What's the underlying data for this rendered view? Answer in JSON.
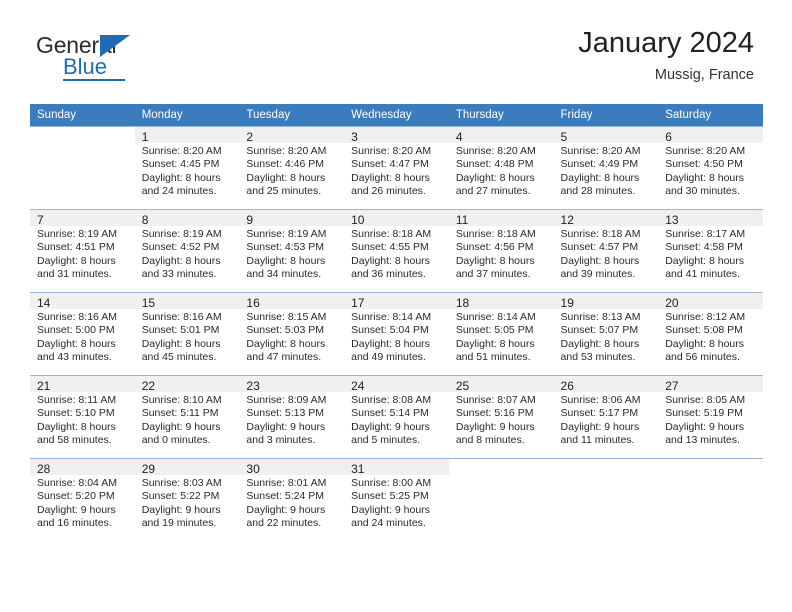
{
  "brand": {
    "name_part1": "General",
    "name_part2": "Blue",
    "accent_color": "#1f6cb4"
  },
  "header": {
    "title": "January 2024",
    "location": "Mussig, France"
  },
  "calendar": {
    "header_color": "#3a7cbd",
    "weekdays": [
      "Sunday",
      "Monday",
      "Tuesday",
      "Wednesday",
      "Thursday",
      "Friday",
      "Saturday"
    ],
    "weeks": [
      [
        {
          "day": "",
          "sunrise": "",
          "sunset": "",
          "daylight1": "",
          "daylight2": ""
        },
        {
          "day": "1",
          "sunrise": "Sunrise: 8:20 AM",
          "sunset": "Sunset: 4:45 PM",
          "daylight1": "Daylight: 8 hours",
          "daylight2": "and 24 minutes."
        },
        {
          "day": "2",
          "sunrise": "Sunrise: 8:20 AM",
          "sunset": "Sunset: 4:46 PM",
          "daylight1": "Daylight: 8 hours",
          "daylight2": "and 25 minutes."
        },
        {
          "day": "3",
          "sunrise": "Sunrise: 8:20 AM",
          "sunset": "Sunset: 4:47 PM",
          "daylight1": "Daylight: 8 hours",
          "daylight2": "and 26 minutes."
        },
        {
          "day": "4",
          "sunrise": "Sunrise: 8:20 AM",
          "sunset": "Sunset: 4:48 PM",
          "daylight1": "Daylight: 8 hours",
          "daylight2": "and 27 minutes."
        },
        {
          "day": "5",
          "sunrise": "Sunrise: 8:20 AM",
          "sunset": "Sunset: 4:49 PM",
          "daylight1": "Daylight: 8 hours",
          "daylight2": "and 28 minutes."
        },
        {
          "day": "6",
          "sunrise": "Sunrise: 8:20 AM",
          "sunset": "Sunset: 4:50 PM",
          "daylight1": "Daylight: 8 hours",
          "daylight2": "and 30 minutes."
        }
      ],
      [
        {
          "day": "7",
          "sunrise": "Sunrise: 8:19 AM",
          "sunset": "Sunset: 4:51 PM",
          "daylight1": "Daylight: 8 hours",
          "daylight2": "and 31 minutes."
        },
        {
          "day": "8",
          "sunrise": "Sunrise: 8:19 AM",
          "sunset": "Sunset: 4:52 PM",
          "daylight1": "Daylight: 8 hours",
          "daylight2": "and 33 minutes."
        },
        {
          "day": "9",
          "sunrise": "Sunrise: 8:19 AM",
          "sunset": "Sunset: 4:53 PM",
          "daylight1": "Daylight: 8 hours",
          "daylight2": "and 34 minutes."
        },
        {
          "day": "10",
          "sunrise": "Sunrise: 8:18 AM",
          "sunset": "Sunset: 4:55 PM",
          "daylight1": "Daylight: 8 hours",
          "daylight2": "and 36 minutes."
        },
        {
          "day": "11",
          "sunrise": "Sunrise: 8:18 AM",
          "sunset": "Sunset: 4:56 PM",
          "daylight1": "Daylight: 8 hours",
          "daylight2": "and 37 minutes."
        },
        {
          "day": "12",
          "sunrise": "Sunrise: 8:18 AM",
          "sunset": "Sunset: 4:57 PM",
          "daylight1": "Daylight: 8 hours",
          "daylight2": "and 39 minutes."
        },
        {
          "day": "13",
          "sunrise": "Sunrise: 8:17 AM",
          "sunset": "Sunset: 4:58 PM",
          "daylight1": "Daylight: 8 hours",
          "daylight2": "and 41 minutes."
        }
      ],
      [
        {
          "day": "14",
          "sunrise": "Sunrise: 8:16 AM",
          "sunset": "Sunset: 5:00 PM",
          "daylight1": "Daylight: 8 hours",
          "daylight2": "and 43 minutes."
        },
        {
          "day": "15",
          "sunrise": "Sunrise: 8:16 AM",
          "sunset": "Sunset: 5:01 PM",
          "daylight1": "Daylight: 8 hours",
          "daylight2": "and 45 minutes."
        },
        {
          "day": "16",
          "sunrise": "Sunrise: 8:15 AM",
          "sunset": "Sunset: 5:03 PM",
          "daylight1": "Daylight: 8 hours",
          "daylight2": "and 47 minutes."
        },
        {
          "day": "17",
          "sunrise": "Sunrise: 8:14 AM",
          "sunset": "Sunset: 5:04 PM",
          "daylight1": "Daylight: 8 hours",
          "daylight2": "and 49 minutes."
        },
        {
          "day": "18",
          "sunrise": "Sunrise: 8:14 AM",
          "sunset": "Sunset: 5:05 PM",
          "daylight1": "Daylight: 8 hours",
          "daylight2": "and 51 minutes."
        },
        {
          "day": "19",
          "sunrise": "Sunrise: 8:13 AM",
          "sunset": "Sunset: 5:07 PM",
          "daylight1": "Daylight: 8 hours",
          "daylight2": "and 53 minutes."
        },
        {
          "day": "20",
          "sunrise": "Sunrise: 8:12 AM",
          "sunset": "Sunset: 5:08 PM",
          "daylight1": "Daylight: 8 hours",
          "daylight2": "and 56 minutes."
        }
      ],
      [
        {
          "day": "21",
          "sunrise": "Sunrise: 8:11 AM",
          "sunset": "Sunset: 5:10 PM",
          "daylight1": "Daylight: 8 hours",
          "daylight2": "and 58 minutes."
        },
        {
          "day": "22",
          "sunrise": "Sunrise: 8:10 AM",
          "sunset": "Sunset: 5:11 PM",
          "daylight1": "Daylight: 9 hours",
          "daylight2": "and 0 minutes."
        },
        {
          "day": "23",
          "sunrise": "Sunrise: 8:09 AM",
          "sunset": "Sunset: 5:13 PM",
          "daylight1": "Daylight: 9 hours",
          "daylight2": "and 3 minutes."
        },
        {
          "day": "24",
          "sunrise": "Sunrise: 8:08 AM",
          "sunset": "Sunset: 5:14 PM",
          "daylight1": "Daylight: 9 hours",
          "daylight2": "and 5 minutes."
        },
        {
          "day": "25",
          "sunrise": "Sunrise: 8:07 AM",
          "sunset": "Sunset: 5:16 PM",
          "daylight1": "Daylight: 9 hours",
          "daylight2": "and 8 minutes."
        },
        {
          "day": "26",
          "sunrise": "Sunrise: 8:06 AM",
          "sunset": "Sunset: 5:17 PM",
          "daylight1": "Daylight: 9 hours",
          "daylight2": "and 11 minutes."
        },
        {
          "day": "27",
          "sunrise": "Sunrise: 8:05 AM",
          "sunset": "Sunset: 5:19 PM",
          "daylight1": "Daylight: 9 hours",
          "daylight2": "and 13 minutes."
        }
      ],
      [
        {
          "day": "28",
          "sunrise": "Sunrise: 8:04 AM",
          "sunset": "Sunset: 5:20 PM",
          "daylight1": "Daylight: 9 hours",
          "daylight2": "and 16 minutes."
        },
        {
          "day": "29",
          "sunrise": "Sunrise: 8:03 AM",
          "sunset": "Sunset: 5:22 PM",
          "daylight1": "Daylight: 9 hours",
          "daylight2": "and 19 minutes."
        },
        {
          "day": "30",
          "sunrise": "Sunrise: 8:01 AM",
          "sunset": "Sunset: 5:24 PM",
          "daylight1": "Daylight: 9 hours",
          "daylight2": "and 22 minutes."
        },
        {
          "day": "31",
          "sunrise": "Sunrise: 8:00 AM",
          "sunset": "Sunset: 5:25 PM",
          "daylight1": "Daylight: 9 hours",
          "daylight2": "and 24 minutes."
        },
        {
          "day": "",
          "sunrise": "",
          "sunset": "",
          "daylight1": "",
          "daylight2": ""
        },
        {
          "day": "",
          "sunrise": "",
          "sunset": "",
          "daylight1": "",
          "daylight2": ""
        },
        {
          "day": "",
          "sunrise": "",
          "sunset": "",
          "daylight1": "",
          "daylight2": ""
        }
      ]
    ]
  }
}
